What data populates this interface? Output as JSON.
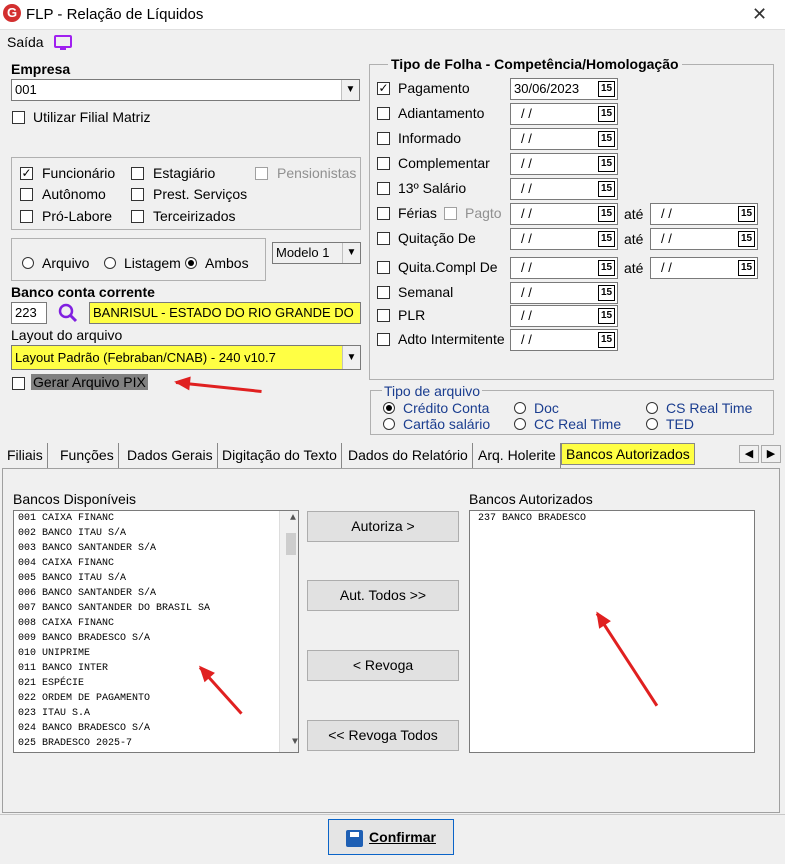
{
  "window": {
    "title": "FLP - Relação de Líquidos",
    "close": "✕",
    "logo": "G"
  },
  "menu": {
    "saida": "Saída"
  },
  "empresa": {
    "label": "Empresa",
    "value": "001",
    "filial_matriz": "Utilizar Filial Matriz"
  },
  "tipos": {
    "funcionario": "Funcionário",
    "estagiario": "Estagiário",
    "pensionistas": "Pensionistas",
    "autonomo": "Autônomo",
    "prest_servicos": "Prest. Serviços",
    "pro_labore": "Pró-Labore",
    "terceirizados": "Terceirizados"
  },
  "saida_tipo": {
    "arquivo": "Arquivo",
    "listagem": "Listagem",
    "ambos": "Ambos",
    "modelo": "Modelo 1"
  },
  "banco": {
    "label": "Banco conta corrente",
    "code": "223",
    "name": "BANRISUL - ESTADO DO RIO GRANDE DO"
  },
  "layout": {
    "label": "Layout do arquivo",
    "value": "Layout Padrão (Febraban/CNAB) - 240 v10.7",
    "pix": "Gerar Arquivo PIX"
  },
  "folha": {
    "header": "Tipo de Folha  -  Competência/Homologação",
    "ate": "até",
    "cal": "15",
    "rows": [
      {
        "label": "Pagamento",
        "checked": true,
        "date": "30/06/2023"
      },
      {
        "label": "Adiantamento",
        "checked": false,
        "date": "/ /"
      },
      {
        "label": "Informado",
        "checked": false,
        "date": "/ /"
      },
      {
        "label": "Complementar",
        "checked": false,
        "date": "/ /"
      },
      {
        "label": "13º Salário",
        "checked": false,
        "date": "/ /"
      },
      {
        "label": "Férias",
        "checked": false,
        "date": "/ /",
        "extra": "Pagto",
        "date2": "/ /"
      },
      {
        "label": "Quitação De",
        "checked": false,
        "date": "/ /",
        "date2": "/ /"
      },
      {
        "label": "Quita.Compl De",
        "checked": false,
        "date": "/ /",
        "date2": "/ /"
      },
      {
        "label": "Semanal",
        "checked": false,
        "date": "/ /"
      },
      {
        "label": "PLR",
        "checked": false,
        "date": "/ /"
      },
      {
        "label": "Adto Intermitente",
        "checked": false,
        "date": "/ /"
      }
    ]
  },
  "tipo_arquivo": {
    "label": "Tipo de arquivo",
    "credito": "Crédito Conta",
    "doc": "Doc",
    "cs_rt": "CS Real Time",
    "cartao": "Cartão salário",
    "cc_rt": "CC Real Time",
    "ted": "TED"
  },
  "tabs": [
    "Filiais",
    "Funções",
    "Dados Gerais",
    "Digitação do Texto",
    "Dados do Relatório",
    "Arq. Holerite",
    "Bancos Autorizados"
  ],
  "bancos": {
    "disp_label": "Bancos Disponíveis",
    "aut_label": "Bancos Autorizados",
    "disponiveis": [
      "001 CAIXA FINANC",
      "002 BANCO ITAU S/A",
      "003 BANCO SANTANDER S/A",
      "004 CAIXA FINANC",
      "005 BANCO ITAU S/A",
      "006 BANCO SANTANDER S/A",
      "007 BANCO SANTANDER DO BRASIL SA",
      "008 CAIXA FINANC",
      "009 BANCO BRADESCO S/A",
      "010 UNIPRIME",
      "011 BANCO INTER",
      "021 ESPÉCIE",
      "022 ORDEM DE PAGAMENTO",
      "023 ITAU S.A",
      "024 BANCO BRADESCO S/A",
      "025 BRADESCO 2025-7"
    ],
    "autorizados": [
      "237 BANCO BRADESCO"
    ],
    "btn_autoriza": "Autoriza >",
    "btn_aut_todos": "Aut. Todos >>",
    "btn_revoga": "< Revoga",
    "btn_revoga_todos": "<< Revoga Todos"
  },
  "confirmar": "Confirmar",
  "colors": {
    "highlight": "#ffff44",
    "arrow": "#e02020",
    "accent": "#a020f0"
  }
}
